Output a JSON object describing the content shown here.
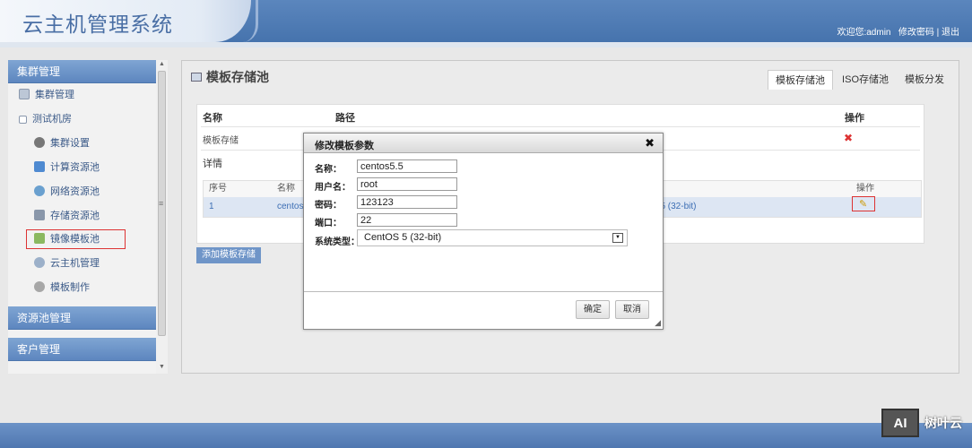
{
  "header": {
    "app_title": "云主机管理系统",
    "welcome": "欢迎您:admin",
    "change_password": "修改密码",
    "separator": "|",
    "logout": "退出"
  },
  "sidebar": {
    "sections": [
      {
        "label": "集群管理"
      },
      {
        "label": "资源池管理"
      },
      {
        "label": "客户管理"
      }
    ],
    "items": [
      {
        "label": "集群管理",
        "icon": "cluster-icon"
      },
      {
        "label": "测试机房",
        "icon": "expand-icon"
      },
      {
        "label": "集群设置",
        "icon": "gear-icon"
      },
      {
        "label": "计算资源池",
        "icon": "compute-icon"
      },
      {
        "label": "网络资源池",
        "icon": "network-icon"
      },
      {
        "label": "存储资源池",
        "icon": "storage-icon"
      },
      {
        "label": "镜像模板池",
        "icon": "image-template-icon"
      },
      {
        "label": "云主机管理",
        "icon": "vm-icon"
      },
      {
        "label": "模板制作",
        "icon": "template-make-icon"
      }
    ],
    "selected": "镜像模板池"
  },
  "main": {
    "title": "模板存储池",
    "tabs": [
      {
        "label": "模板存储池",
        "active": true
      },
      {
        "label": "ISO存储池",
        "active": false
      },
      {
        "label": "模板分发",
        "active": false
      }
    ],
    "columns": {
      "name": "名称",
      "path": "路径",
      "action": "操作"
    },
    "row": {
      "name": "模板存储"
    },
    "details_label": "详情",
    "detail_table": {
      "headers": [
        "序号",
        "名称",
        "操作"
      ],
      "row": {
        "index": "1",
        "name": "centos",
        "os_fragment": "S 5 (32-bit)"
      }
    },
    "add_button": "添加模板存储"
  },
  "modal": {
    "title": "修改模板参数",
    "close": "✖",
    "fields": [
      {
        "label": "名称：",
        "value": "centos5.5"
      },
      {
        "label": "用户名：",
        "value": "root"
      },
      {
        "label": "密码：",
        "value": "123123"
      },
      {
        "label": "端口：",
        "value": "22"
      }
    ],
    "os_type_label": "系统类型：",
    "os_type_value": "CentOS 5 (32-bit)",
    "confirm": "确定",
    "cancel": "取消"
  },
  "watermark": {
    "logo": "AI",
    "text": "树叶云"
  },
  "colors": {
    "header": "#4f7ab3",
    "accent": "#6f95c8",
    "danger": "#dd3333",
    "row_highlight": "#dde6f3"
  }
}
